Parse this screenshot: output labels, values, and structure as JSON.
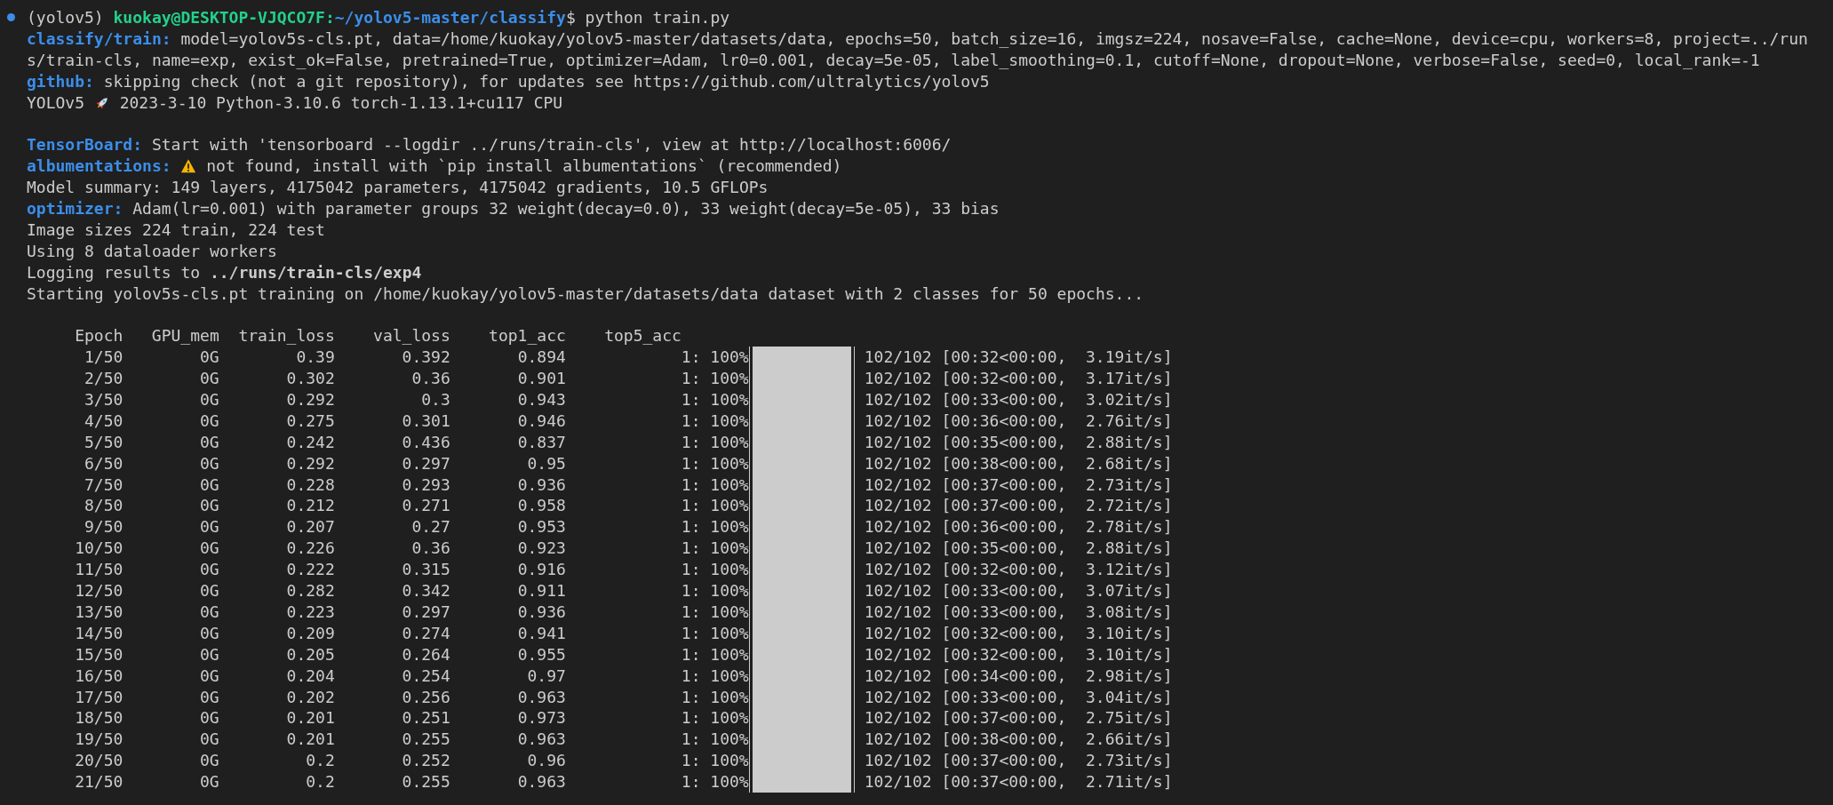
{
  "terminal": {
    "prompt": {
      "env": "(yolov5)",
      "user_host": "kuokay@DESKTOP-VJQCO7F:",
      "path": "~/yolov5-master/classify",
      "command": "$ python train.py"
    },
    "lines": [
      {
        "kind": "log",
        "label": "classify/train:",
        "text": "model=yolov5s-cls.pt, data=/home/kuokay/yolov5-master/datasets/data, epochs=50, batch_size=16, imgsz=224, nosave=False, cache=None, device=cpu, workers=8, project=../run"
      },
      {
        "kind": "log",
        "text": "s/train-cls, name=exp, exist_ok=False, pretrained=True, optimizer=Adam, lr0=0.001, decay=5e-05, label_smoothing=0.1, cutoff=None, dropout=None, verbose=False, seed=0, local_rank=-1"
      },
      {
        "kind": "log",
        "label": "github:",
        "text": "skipping check (not a git repository), for updates see https://github.com/ultralytics/yolov5"
      },
      {
        "kind": "version",
        "before": "YOLOv5",
        "after": "2023-3-10 Python-3.10.6 torch-1.13.1+cu117 CPU"
      },
      {
        "kind": "blank"
      },
      {
        "kind": "log",
        "label": "TensorBoard:",
        "text": "Start with 'tensorboard --logdir ../runs/train-cls', view at http://localhost:6006/"
      },
      {
        "kind": "warning",
        "label": "albumentations:",
        "text": "not found, install with `pip install albumentations` (recommended)"
      },
      {
        "kind": "log",
        "text": "Model summary: 149 layers, 4175042 parameters, 4175042 gradients, 10.5 GFLOPs"
      },
      {
        "kind": "log",
        "label": "optimizer:",
        "text": "Adam(lr=0.001) with parameter groups 32 weight(decay=0.0), 33 weight(decay=5e-05), 33 bias"
      },
      {
        "kind": "log",
        "text": "Image sizes 224 train, 224 test"
      },
      {
        "kind": "log",
        "text": "Using 8 dataloader workers"
      },
      {
        "kind": "log",
        "text": "Logging results to **../runs/train-cls/exp4**"
      },
      {
        "kind": "log",
        "text": "Starting yolov5s-cls.pt training on /home/kuokay/yolov5-master/datasets/data dataset with 2 classes for 50 epochs..."
      },
      {
        "kind": "blank"
      }
    ],
    "table": {
      "columns": [
        "Epoch",
        "GPU_mem",
        "train_loss",
        "val_loss",
        "top1_acc",
        "top5_acc"
      ],
      "rows": [
        {
          "epoch": "1/50",
          "gpu_mem": "0G",
          "train_loss": "0.39",
          "val_loss": "0.392",
          "top1_acc": "0.894",
          "progress": "1: 100%",
          "level": 1,
          "status": "102/102 [00:32<00:00,  3.19it/s]"
        },
        {
          "epoch": "2/50",
          "gpu_mem": "0G",
          "train_loss": "0.302",
          "val_loss": "0.36",
          "top1_acc": "0.901",
          "progress": "1: 100%",
          "level": 1,
          "status": "102/102 [00:32<00:00,  3.17it/s]"
        },
        {
          "epoch": "3/50",
          "gpu_mem": "0G",
          "train_loss": "0.292",
          "val_loss": "0.3",
          "top1_acc": "0.943",
          "progress": "1: 100%",
          "level": 1,
          "status": "102/102 [00:33<00:00,  3.02it/s]"
        },
        {
          "epoch": "4/50",
          "gpu_mem": "0G",
          "train_loss": "0.275",
          "val_loss": "0.301",
          "top1_acc": "0.946",
          "progress": "1: 100%",
          "level": 1,
          "status": "102/102 [00:36<00:00,  2.76it/s]"
        },
        {
          "epoch": "5/50",
          "gpu_mem": "0G",
          "train_loss": "0.242",
          "val_loss": "0.436",
          "top1_acc": "0.837",
          "progress": "1: 100%",
          "level": 1,
          "status": "102/102 [00:35<00:00,  2.88it/s]"
        },
        {
          "epoch": "6/50",
          "gpu_mem": "0G",
          "train_loss": "0.292",
          "val_loss": "0.297",
          "top1_acc": "0.95",
          "progress": "1: 100%",
          "level": 1,
          "status": "102/102 [00:38<00:00,  2.68it/s]"
        },
        {
          "epoch": "7/50",
          "gpu_mem": "0G",
          "train_loss": "0.228",
          "val_loss": "0.293",
          "top1_acc": "0.936",
          "progress": "1: 100%",
          "level": 1,
          "status": "102/102 [00:37<00:00,  2.73it/s]"
        },
        {
          "epoch": "8/50",
          "gpu_mem": "0G",
          "train_loss": "0.212",
          "val_loss": "0.271",
          "top1_acc": "0.958",
          "progress": "1: 100%",
          "level": 1,
          "status": "102/102 [00:37<00:00,  2.72it/s]"
        },
        {
          "epoch": "9/50",
          "gpu_mem": "0G",
          "train_loss": "0.207",
          "val_loss": "0.27",
          "top1_acc": "0.953",
          "progress": "1: 100%",
          "level": 1,
          "status": "102/102 [00:36<00:00,  2.78it/s]"
        },
        {
          "epoch": "10/50",
          "gpu_mem": "0G",
          "train_loss": "0.226",
          "val_loss": "0.36",
          "top1_acc": "0.923",
          "progress": "1: 100%",
          "level": 1,
          "status": "102/102 [00:35<00:00,  2.88it/s]"
        },
        {
          "epoch": "11/50",
          "gpu_mem": "0G",
          "train_loss": "0.222",
          "val_loss": "0.315",
          "top1_acc": "0.916",
          "progress": "1: 100%",
          "level": 1,
          "status": "102/102 [00:32<00:00,  3.12it/s]"
        },
        {
          "epoch": "12/50",
          "gpu_mem": "0G",
          "train_loss": "0.282",
          "val_loss": "0.342",
          "top1_acc": "0.911",
          "progress": "1: 100%",
          "level": 1,
          "status": "102/102 [00:33<00:00,  3.07it/s]"
        },
        {
          "epoch": "13/50",
          "gpu_mem": "0G",
          "train_loss": "0.223",
          "val_loss": "0.297",
          "top1_acc": "0.936",
          "progress": "1: 100%",
          "level": 1,
          "status": "102/102 [00:33<00:00,  3.08it/s]"
        },
        {
          "epoch": "14/50",
          "gpu_mem": "0G",
          "train_loss": "0.209",
          "val_loss": "0.274",
          "top1_acc": "0.941",
          "progress": "1: 100%",
          "level": 1,
          "status": "102/102 [00:32<00:00,  3.10it/s]"
        },
        {
          "epoch": "15/50",
          "gpu_mem": "0G",
          "train_loss": "0.205",
          "val_loss": "0.264",
          "top1_acc": "0.955",
          "progress": "1: 100%",
          "level": 1,
          "status": "102/102 [00:32<00:00,  3.10it/s]"
        },
        {
          "epoch": "16/50",
          "gpu_mem": "0G",
          "train_loss": "0.204",
          "val_loss": "0.254",
          "top1_acc": "0.97",
          "progress": "1: 100%",
          "level": 1,
          "status": "102/102 [00:34<00:00,  2.98it/s]"
        },
        {
          "epoch": "17/50",
          "gpu_mem": "0G",
          "train_loss": "0.202",
          "val_loss": "0.256",
          "top1_acc": "0.963",
          "progress": "1: 100%",
          "level": 1,
          "status": "102/102 [00:33<00:00,  3.04it/s]"
        },
        {
          "epoch": "18/50",
          "gpu_mem": "0G",
          "train_loss": "0.201",
          "val_loss": "0.251",
          "top1_acc": "0.973",
          "progress": "1: 100%",
          "level": 1,
          "status": "102/102 [00:37<00:00,  2.75it/s]"
        },
        {
          "epoch": "19/50",
          "gpu_mem": "0G",
          "train_loss": "0.201",
          "val_loss": "0.255",
          "top1_acc": "0.963",
          "progress": "1: 100%",
          "level": 1,
          "status": "102/102 [00:38<00:00,  2.66it/s]"
        },
        {
          "epoch": "20/50",
          "gpu_mem": "0G",
          "train_loss": "0.2",
          "val_loss": "0.252",
          "top1_acc": "0.96",
          "progress": "1: 100%",
          "level": 1,
          "status": "102/102 [00:37<00:00,  2.73it/s]"
        },
        {
          "epoch": "21/50",
          "gpu_mem": "0G",
          "train_loss": "0.2",
          "val_loss": "0.255",
          "top1_acc": "0.963",
          "progress": "1: 100%",
          "level": 1,
          "status": "102/102 [00:37<00:00,  2.71it/s]"
        }
      ]
    }
  }
}
